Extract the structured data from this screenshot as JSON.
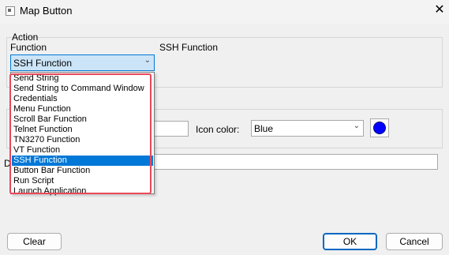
{
  "window": {
    "title": "Map Button",
    "close_glyph": "✕",
    "icon": "app-window-icon"
  },
  "action": {
    "group_label": "Action",
    "function_label": "Function",
    "selected_function": "SSH Function",
    "function_description": "SSH Function",
    "dropdown_options": [
      "Send String",
      "Send String to Command Window",
      "Credentials",
      "Menu Function",
      "Scroll Bar Function",
      "Telnet Function",
      "TN3270 Function",
      "VT Function",
      "SSH Function",
      "Button Bar Function",
      "Run Script",
      "Launch Application"
    ]
  },
  "appearance": {
    "icon_color_label": "Icon color:",
    "icon_color_value": "Blue",
    "icon_color_hex": "#0000ff",
    "description_label_partial": "D"
  },
  "buttons": {
    "clear": "Clear",
    "ok": "OK",
    "cancel": "Cancel"
  },
  "colors": {
    "highlight_border": "#e8485a",
    "selection": "#0078d7"
  }
}
